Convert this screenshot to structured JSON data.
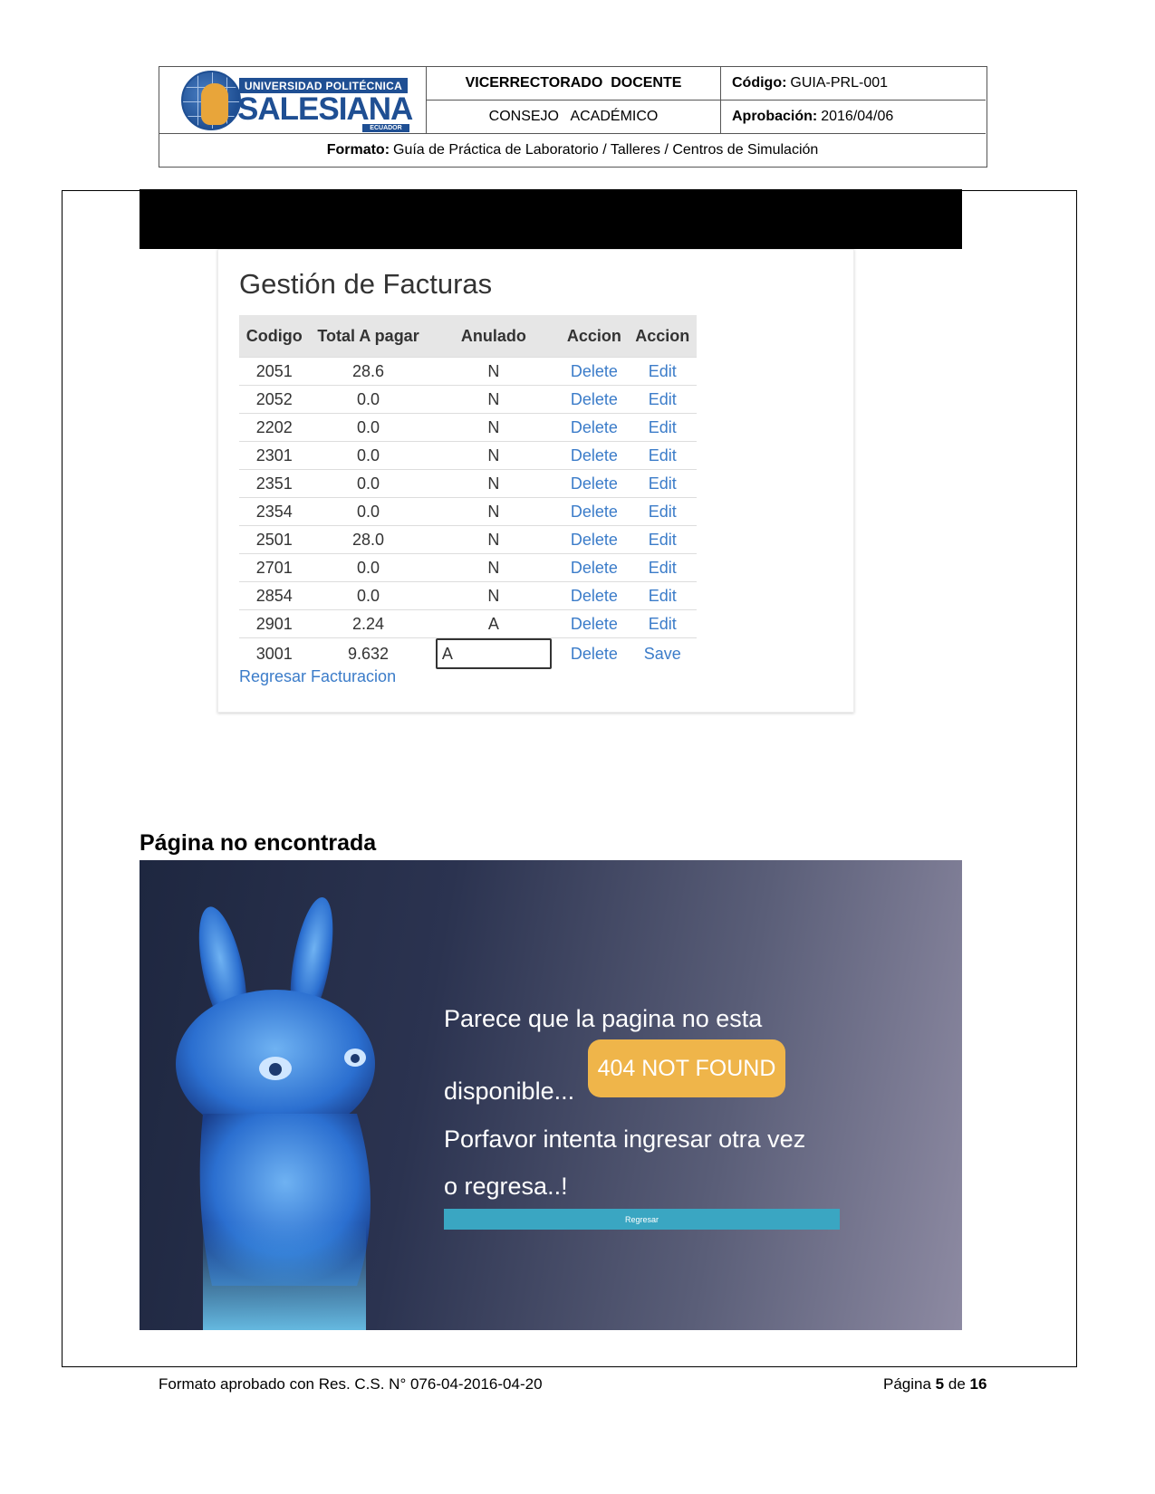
{
  "header": {
    "logo": {
      "top": "UNIVERSIDAD POLITÉCNICA",
      "main": "SALESIANA",
      "sub": "ECUADOR"
    },
    "department": "VICERRECTORADO  DOCENTE",
    "council": "CONSEJO   ACADÉMICO",
    "code_label": "Código:",
    "code_value": "GUIA-PRL-001",
    "approval_label": "Aprobación:",
    "approval_value": "2016/04/06",
    "format_label": "Formato:",
    "format_value": "Guía de Práctica de Laboratorio / Talleres / Centros de Simulación"
  },
  "invoices": {
    "title": "Gestión de Facturas",
    "columns": [
      "Codigo",
      "Total A pagar",
      "Anulado",
      "Accion",
      "Accion"
    ],
    "rows": [
      {
        "codigo": "2051",
        "total": "28.6",
        "anulado": "N",
        "action1": "Delete",
        "action2": "Edit"
      },
      {
        "codigo": "2052",
        "total": "0.0",
        "anulado": "N",
        "action1": "Delete",
        "action2": "Edit"
      },
      {
        "codigo": "2202",
        "total": "0.0",
        "anulado": "N",
        "action1": "Delete",
        "action2": "Edit"
      },
      {
        "codigo": "2301",
        "total": "0.0",
        "anulado": "N",
        "action1": "Delete",
        "action2": "Edit"
      },
      {
        "codigo": "2351",
        "total": "0.0",
        "anulado": "N",
        "action1": "Delete",
        "action2": "Edit"
      },
      {
        "codigo": "2354",
        "total": "0.0",
        "anulado": "N",
        "action1": "Delete",
        "action2": "Edit"
      },
      {
        "codigo": "2501",
        "total": "28.0",
        "anulado": "N",
        "action1": "Delete",
        "action2": "Edit"
      },
      {
        "codigo": "2701",
        "total": "0.0",
        "anulado": "N",
        "action1": "Delete",
        "action2": "Edit"
      },
      {
        "codigo": "2854",
        "total": "0.0",
        "anulado": "N",
        "action1": "Delete",
        "action2": "Edit"
      },
      {
        "codigo": "2901",
        "total": "2.24",
        "anulado": "A",
        "action1": "Delete",
        "action2": "Edit"
      }
    ],
    "editing_row": {
      "codigo": "3001",
      "total": "9.632",
      "anulado_value": "A",
      "action1": "Delete",
      "action2": "Save"
    },
    "back_link": "Regresar Facturacion"
  },
  "not_found": {
    "section_title": "Página no encontrada",
    "line1": "Parece que la pagina no esta",
    "line2": "disponible...",
    "badge": "404 NOT FOUND",
    "line3": "Porfavor intenta ingresar otra vez",
    "line4": "o regresa..!",
    "button": "Regresar"
  },
  "footer": {
    "left": "Formato aprobado con Res. C.S. N° 076-04-2016-04-20",
    "page_label": "Página",
    "page_current": "5",
    "page_of": "de",
    "page_total": "16"
  }
}
